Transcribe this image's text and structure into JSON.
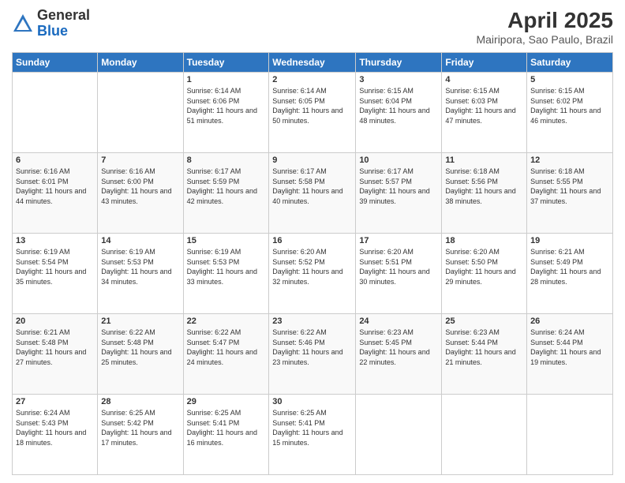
{
  "logo": {
    "general": "General",
    "blue": "Blue"
  },
  "title": "April 2025",
  "location": "Mairipora, Sao Paulo, Brazil",
  "weekdays": [
    "Sunday",
    "Monday",
    "Tuesday",
    "Wednesday",
    "Thursday",
    "Friday",
    "Saturday"
  ],
  "weeks": [
    [
      {
        "day": "",
        "sunrise": "",
        "sunset": "",
        "daylight": ""
      },
      {
        "day": "",
        "sunrise": "",
        "sunset": "",
        "daylight": ""
      },
      {
        "day": "1",
        "sunrise": "Sunrise: 6:14 AM",
        "sunset": "Sunset: 6:06 PM",
        "daylight": "Daylight: 11 hours and 51 minutes."
      },
      {
        "day": "2",
        "sunrise": "Sunrise: 6:14 AM",
        "sunset": "Sunset: 6:05 PM",
        "daylight": "Daylight: 11 hours and 50 minutes."
      },
      {
        "day": "3",
        "sunrise": "Sunrise: 6:15 AM",
        "sunset": "Sunset: 6:04 PM",
        "daylight": "Daylight: 11 hours and 48 minutes."
      },
      {
        "day": "4",
        "sunrise": "Sunrise: 6:15 AM",
        "sunset": "Sunset: 6:03 PM",
        "daylight": "Daylight: 11 hours and 47 minutes."
      },
      {
        "day": "5",
        "sunrise": "Sunrise: 6:15 AM",
        "sunset": "Sunset: 6:02 PM",
        "daylight": "Daylight: 11 hours and 46 minutes."
      }
    ],
    [
      {
        "day": "6",
        "sunrise": "Sunrise: 6:16 AM",
        "sunset": "Sunset: 6:01 PM",
        "daylight": "Daylight: 11 hours and 44 minutes."
      },
      {
        "day": "7",
        "sunrise": "Sunrise: 6:16 AM",
        "sunset": "Sunset: 6:00 PM",
        "daylight": "Daylight: 11 hours and 43 minutes."
      },
      {
        "day": "8",
        "sunrise": "Sunrise: 6:17 AM",
        "sunset": "Sunset: 5:59 PM",
        "daylight": "Daylight: 11 hours and 42 minutes."
      },
      {
        "day": "9",
        "sunrise": "Sunrise: 6:17 AM",
        "sunset": "Sunset: 5:58 PM",
        "daylight": "Daylight: 11 hours and 40 minutes."
      },
      {
        "day": "10",
        "sunrise": "Sunrise: 6:17 AM",
        "sunset": "Sunset: 5:57 PM",
        "daylight": "Daylight: 11 hours and 39 minutes."
      },
      {
        "day": "11",
        "sunrise": "Sunrise: 6:18 AM",
        "sunset": "Sunset: 5:56 PM",
        "daylight": "Daylight: 11 hours and 38 minutes."
      },
      {
        "day": "12",
        "sunrise": "Sunrise: 6:18 AM",
        "sunset": "Sunset: 5:55 PM",
        "daylight": "Daylight: 11 hours and 37 minutes."
      }
    ],
    [
      {
        "day": "13",
        "sunrise": "Sunrise: 6:19 AM",
        "sunset": "Sunset: 5:54 PM",
        "daylight": "Daylight: 11 hours and 35 minutes."
      },
      {
        "day": "14",
        "sunrise": "Sunrise: 6:19 AM",
        "sunset": "Sunset: 5:53 PM",
        "daylight": "Daylight: 11 hours and 34 minutes."
      },
      {
        "day": "15",
        "sunrise": "Sunrise: 6:19 AM",
        "sunset": "Sunset: 5:53 PM",
        "daylight": "Daylight: 11 hours and 33 minutes."
      },
      {
        "day": "16",
        "sunrise": "Sunrise: 6:20 AM",
        "sunset": "Sunset: 5:52 PM",
        "daylight": "Daylight: 11 hours and 32 minutes."
      },
      {
        "day": "17",
        "sunrise": "Sunrise: 6:20 AM",
        "sunset": "Sunset: 5:51 PM",
        "daylight": "Daylight: 11 hours and 30 minutes."
      },
      {
        "day": "18",
        "sunrise": "Sunrise: 6:20 AM",
        "sunset": "Sunset: 5:50 PM",
        "daylight": "Daylight: 11 hours and 29 minutes."
      },
      {
        "day": "19",
        "sunrise": "Sunrise: 6:21 AM",
        "sunset": "Sunset: 5:49 PM",
        "daylight": "Daylight: 11 hours and 28 minutes."
      }
    ],
    [
      {
        "day": "20",
        "sunrise": "Sunrise: 6:21 AM",
        "sunset": "Sunset: 5:48 PM",
        "daylight": "Daylight: 11 hours and 27 minutes."
      },
      {
        "day": "21",
        "sunrise": "Sunrise: 6:22 AM",
        "sunset": "Sunset: 5:48 PM",
        "daylight": "Daylight: 11 hours and 25 minutes."
      },
      {
        "day": "22",
        "sunrise": "Sunrise: 6:22 AM",
        "sunset": "Sunset: 5:47 PM",
        "daylight": "Daylight: 11 hours and 24 minutes."
      },
      {
        "day": "23",
        "sunrise": "Sunrise: 6:22 AM",
        "sunset": "Sunset: 5:46 PM",
        "daylight": "Daylight: 11 hours and 23 minutes."
      },
      {
        "day": "24",
        "sunrise": "Sunrise: 6:23 AM",
        "sunset": "Sunset: 5:45 PM",
        "daylight": "Daylight: 11 hours and 22 minutes."
      },
      {
        "day": "25",
        "sunrise": "Sunrise: 6:23 AM",
        "sunset": "Sunset: 5:44 PM",
        "daylight": "Daylight: 11 hours and 21 minutes."
      },
      {
        "day": "26",
        "sunrise": "Sunrise: 6:24 AM",
        "sunset": "Sunset: 5:44 PM",
        "daylight": "Daylight: 11 hours and 19 minutes."
      }
    ],
    [
      {
        "day": "27",
        "sunrise": "Sunrise: 6:24 AM",
        "sunset": "Sunset: 5:43 PM",
        "daylight": "Daylight: 11 hours and 18 minutes."
      },
      {
        "day": "28",
        "sunrise": "Sunrise: 6:25 AM",
        "sunset": "Sunset: 5:42 PM",
        "daylight": "Daylight: 11 hours and 17 minutes."
      },
      {
        "day": "29",
        "sunrise": "Sunrise: 6:25 AM",
        "sunset": "Sunset: 5:41 PM",
        "daylight": "Daylight: 11 hours and 16 minutes."
      },
      {
        "day": "30",
        "sunrise": "Sunrise: 6:25 AM",
        "sunset": "Sunset: 5:41 PM",
        "daylight": "Daylight: 11 hours and 15 minutes."
      },
      {
        "day": "",
        "sunrise": "",
        "sunset": "",
        "daylight": ""
      },
      {
        "day": "",
        "sunrise": "",
        "sunset": "",
        "daylight": ""
      },
      {
        "day": "",
        "sunrise": "",
        "sunset": "",
        "daylight": ""
      }
    ]
  ]
}
